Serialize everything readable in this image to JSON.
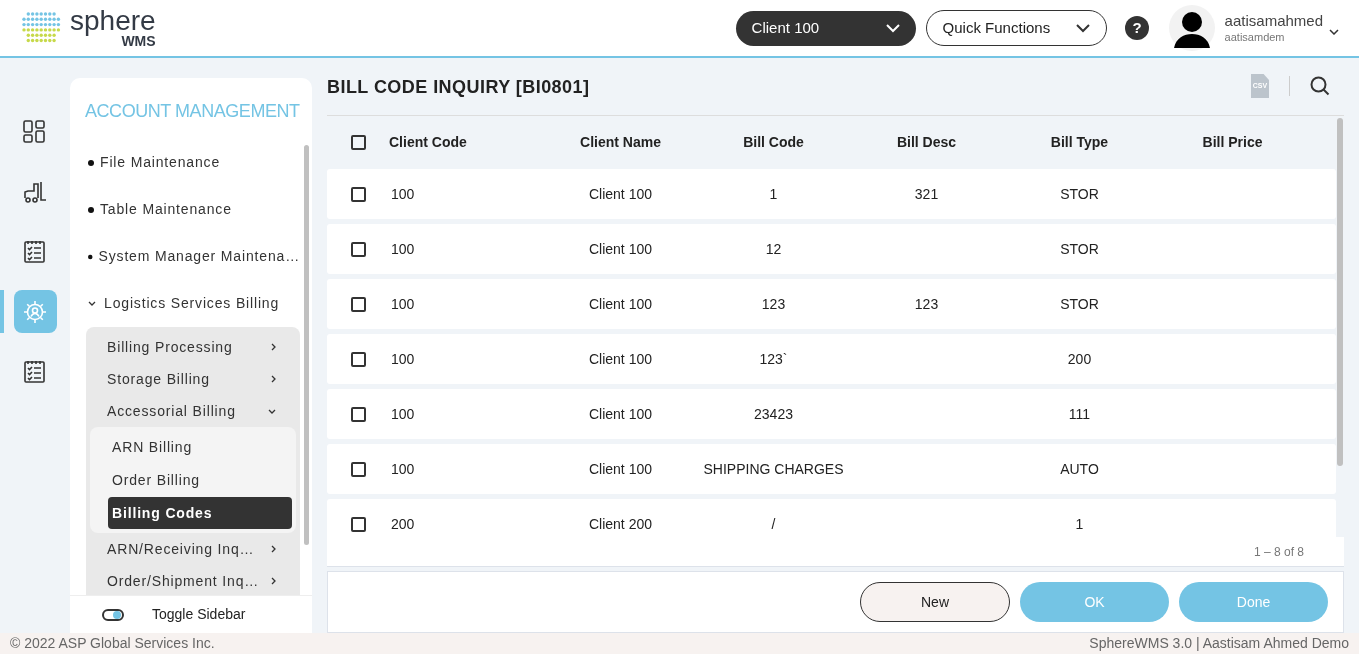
{
  "header": {
    "logo": {
      "name": "sphere",
      "sub": "WMS"
    },
    "client_select": {
      "value": "Client 100"
    },
    "quick_functions": {
      "label": "Quick Functions"
    },
    "user": {
      "name": "aatisamahmed",
      "login": "aatisamdem"
    }
  },
  "help": {
    "label": "?"
  },
  "rail": [
    {
      "selected": false
    },
    {
      "selected": false
    },
    {
      "selected": false
    },
    {
      "selected": true
    },
    {
      "selected": false
    }
  ],
  "sidebar": {
    "title": "ACCOUNT MANAGEMENT",
    "items": [
      {
        "label": "File Maintenance",
        "kind": "bullet"
      },
      {
        "label": "Table Maintenance",
        "kind": "bullet"
      },
      {
        "label": "System Manager Maintena…",
        "kind": "bullet"
      },
      {
        "label": "Logistics Services Billing",
        "kind": "group",
        "expanded": true,
        "children": [
          {
            "label": "Billing Processing",
            "expanded": false
          },
          {
            "label": "Storage Billing",
            "expanded": false
          },
          {
            "label": "Accessorial Billing",
            "expanded": true,
            "children": [
              {
                "label": "ARN Billing",
                "selected": false
              },
              {
                "label": "Order Billing",
                "selected": false
              },
              {
                "label": "Billing Codes",
                "selected": true
              }
            ]
          },
          {
            "label": "ARN/Receiving Inq…",
            "expanded": false
          },
          {
            "label": "Order/Shipment Inq…",
            "expanded": false
          }
        ]
      }
    ],
    "toggle": {
      "label": "Toggle Sidebar",
      "on": true
    }
  },
  "page": {
    "title": "BILL CODE INQUIRY [BI0801]",
    "export_label": "CSV"
  },
  "table": {
    "columns": [
      "Client Code",
      "Client Name",
      "Bill Code",
      "Bill Desc",
      "Bill Type",
      "Bill Price"
    ],
    "all_checked": false,
    "rows": [
      {
        "checked": false,
        "cells": [
          "100",
          "Client 100",
          "1",
          "321",
          "STOR",
          ""
        ]
      },
      {
        "checked": false,
        "cells": [
          "100",
          "Client 100",
          "12",
          "",
          "STOR",
          ""
        ]
      },
      {
        "checked": false,
        "cells": [
          "100",
          "Client 100",
          "123",
          "123",
          "STOR",
          ""
        ]
      },
      {
        "checked": false,
        "cells": [
          "100",
          "Client 100",
          "123`",
          "",
          "200",
          ""
        ]
      },
      {
        "checked": false,
        "cells": [
          "100",
          "Client 100",
          "23423",
          "",
          "111",
          ""
        ]
      },
      {
        "checked": false,
        "cells": [
          "100",
          "Client 100",
          "SHIPPING CHARGES",
          "",
          "AUTO",
          ""
        ]
      },
      {
        "checked": false,
        "cells": [
          "200",
          "Client 200",
          "/",
          "",
          "1",
          ""
        ]
      }
    ],
    "pagination": "1 – 8 of 8"
  },
  "buttons": [
    {
      "label": "New",
      "kind": "outline"
    },
    {
      "label": "OK",
      "kind": "primary"
    },
    {
      "label": "Done",
      "kind": "primary"
    }
  ],
  "footer": {
    "left": "© 2022 ASP Global Services Inc.",
    "right": "SphereWMS 3.0 | Aastisam Ahmed Demo"
  }
}
